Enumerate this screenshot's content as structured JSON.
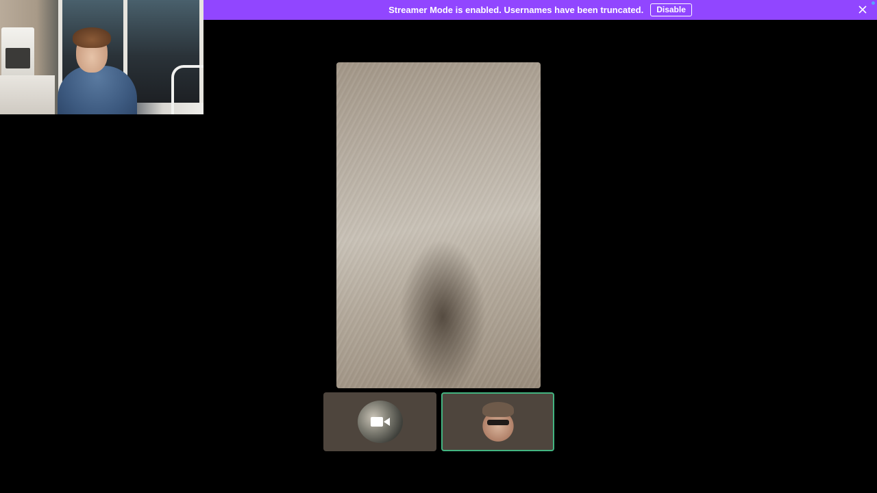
{
  "banner": {
    "message": "Streamer Mode is enabled. Usernames have been truncated.",
    "disable_label": "Disable",
    "close_icon": "close-icon",
    "background_color": "#9146ff"
  },
  "webcam_overlay": {
    "description": "self-view camera feed"
  },
  "main_video": {
    "content": "camera view of floor"
  },
  "participants": [
    {
      "avatar_icon": "camera-icon",
      "speaking": false
    },
    {
      "avatar_icon": "avatar",
      "speaking": true,
      "highlight_color": "#43b581"
    }
  ]
}
